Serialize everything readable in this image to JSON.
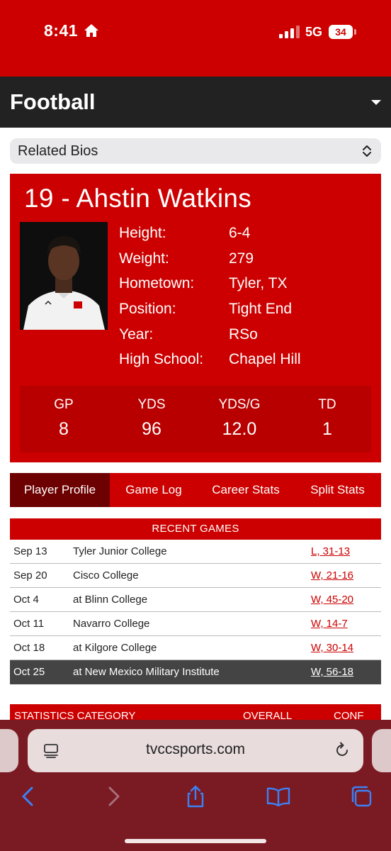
{
  "status_bar": {
    "time": "8:41",
    "network": "5G",
    "battery": "34",
    "home_icon": "house-icon"
  },
  "header": {
    "sport": "Football"
  },
  "related_bios": {
    "label": "Related Bios"
  },
  "player": {
    "title": "19 - Ahstin Watkins",
    "bio": [
      {
        "label": "Height:",
        "value": "6-4"
      },
      {
        "label": "Weight:",
        "value": "279"
      },
      {
        "label": "Hometown:",
        "value": "Tyler, TX"
      },
      {
        "label": "Position:",
        "value": "Tight End"
      },
      {
        "label": "Year:",
        "value": "RSo"
      },
      {
        "label": "High School:",
        "value": "Chapel Hill"
      }
    ],
    "stats": [
      {
        "label": "GP",
        "value": "8"
      },
      {
        "label": "YDS",
        "value": "96"
      },
      {
        "label": "YDS/G",
        "value": "12.0"
      },
      {
        "label": "TD",
        "value": "1"
      }
    ]
  },
  "tabs": [
    {
      "label": "Player Profile",
      "active": true
    },
    {
      "label": "Game Log",
      "active": false
    },
    {
      "label": "Career Stats",
      "active": false
    },
    {
      "label": "Split Stats",
      "active": false
    }
  ],
  "recent_games": {
    "heading": "RECENT GAMES",
    "rows": [
      {
        "date": "Sep 13",
        "opponent": "Tyler Junior College",
        "result": "L, 31-13"
      },
      {
        "date": "Sep 20",
        "opponent": "Cisco College",
        "result": "W, 21-16"
      },
      {
        "date": "Oct 4",
        "opponent": "at Blinn College",
        "result": "W, 45-20"
      },
      {
        "date": "Oct 11",
        "opponent": "Navarro College",
        "result": "W, 14-7"
      },
      {
        "date": "Oct 18",
        "opponent": "at Kilgore College",
        "result": "W, 30-14"
      },
      {
        "date": "Oct 25",
        "opponent": "at New Mexico Military Institute",
        "result": "W, 56-18"
      }
    ]
  },
  "statistics": {
    "category_label": "STATISTICS CATEGORY",
    "overall_label": "OVERALL",
    "conf_label": "CONF"
  },
  "browser": {
    "url": "tvccsports.com"
  },
  "colors": {
    "brand_red": "#cc0000",
    "dark_header": "#222222",
    "active_tab": "#6d0000",
    "safari_chrome": "#7a1a22"
  }
}
